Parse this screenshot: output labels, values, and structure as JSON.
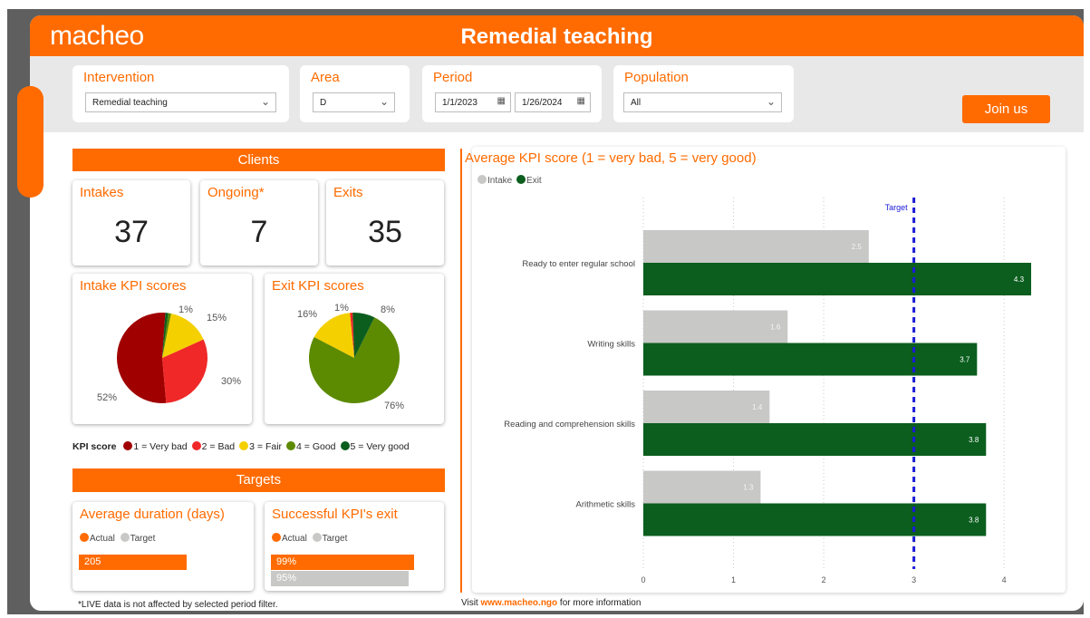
{
  "header": {
    "logo": "macheo",
    "title": "Remedial teaching"
  },
  "filters": {
    "intervention": {
      "label": "Intervention",
      "value": "Remedial teaching"
    },
    "area": {
      "label": "Area",
      "value": "D"
    },
    "period": {
      "label": "Period",
      "start": "1/1/2023",
      "end": "1/26/2024"
    },
    "population": {
      "label": "Population",
      "value": "All"
    }
  },
  "join_button": "Join us",
  "clients": {
    "banner": "Clients",
    "intakes": {
      "label": "Intakes",
      "value": "37"
    },
    "ongoing": {
      "label": "Ongoing*",
      "value": "7"
    },
    "exits": {
      "label": "Exits",
      "value": "35"
    }
  },
  "kpi_pies": {
    "intake": {
      "title": "Intake KPI scores",
      "slices": [
        52,
        30,
        15,
        1,
        1
      ],
      "labels": [
        "52%",
        "30%",
        "15%",
        "1%"
      ]
    },
    "exit": {
      "title": "Exit KPI scores",
      "slices": [
        0,
        1,
        16,
        76,
        8
      ],
      "labels": [
        "76%",
        "16%",
        "1%",
        "8%"
      ]
    }
  },
  "kpi_legend": {
    "title": "KPI score",
    "items": [
      {
        "label": "1 = Very bad",
        "color": "#a00000"
      },
      {
        "label": "2 = Bad",
        "color": "#f02828"
      },
      {
        "label": "3 = Fair",
        "color": "#f5d000"
      },
      {
        "label": "4 = Good",
        "color": "#5c8a00"
      },
      {
        "label": "5 = Very good",
        "color": "#0b5e1e"
      }
    ]
  },
  "targets": {
    "banner": "Targets",
    "duration": {
      "title": "Average duration (days)",
      "actual_label": "Actual",
      "target_label": "Target",
      "actual_value": "205",
      "actual_fraction": 0.85
    },
    "success": {
      "title": "Successful KPI's exit",
      "actual_label": "Actual",
      "target_label": "Target",
      "actual_value": "99%",
      "target_value": "95%",
      "actual_fraction": 0.99,
      "target_fraction": 0.95
    }
  },
  "footer": {
    "note": "*LIVE data is not affected by selected period filter.",
    "visit_prefix": "Visit ",
    "url": "www.macheo.ngo",
    "visit_suffix": " for more information"
  },
  "colors": {
    "accent": "#ff6b00",
    "intake": "#c8c8c6",
    "exit": "#0b5e1e",
    "target": "#1a1ad6"
  },
  "chart_data": {
    "type": "bar",
    "title": "Average KPI score (1 = very bad, 5 = very good)",
    "categories": [
      "Ready to enter regular school",
      "Writing skills",
      "Reading and comprehension skills",
      "Arithmetic skills"
    ],
    "series": [
      {
        "name": "Intake",
        "values": [
          2.5,
          1.6,
          1.4,
          1.3
        ]
      },
      {
        "name": "Exit",
        "values": [
          4.3,
          3.7,
          3.8,
          3.8
        ]
      }
    ],
    "target": 3,
    "target_label": "Target",
    "xlim": [
      0,
      4.4
    ],
    "xticks": [
      0,
      1,
      2,
      3,
      4
    ],
    "orientation": "horizontal"
  }
}
